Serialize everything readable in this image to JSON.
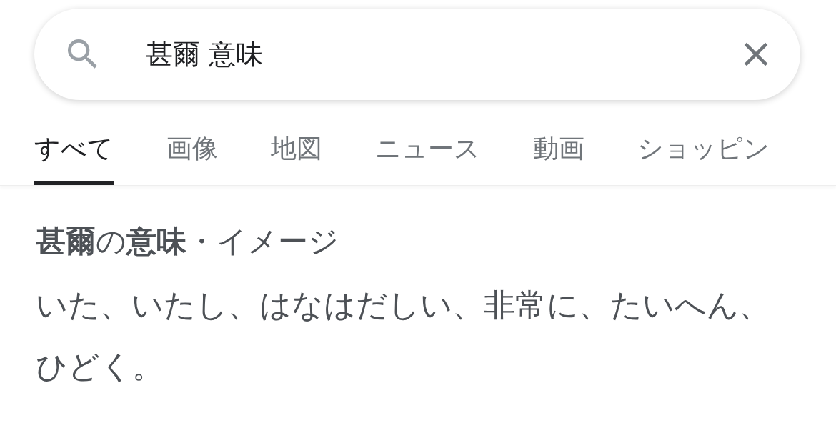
{
  "search": {
    "value": "甚爾 意味"
  },
  "tabs": [
    {
      "label": "すべて",
      "selected": true
    },
    {
      "label": "画像",
      "selected": false
    },
    {
      "label": "地図",
      "selected": false
    },
    {
      "label": "ニュース",
      "selected": false
    },
    {
      "label": "動画",
      "selected": false
    },
    {
      "label": "ショッピン",
      "selected": false
    }
  ],
  "result": {
    "title": "**甚爾**の**意味**・イメージ",
    "text": "いた、いたし、はなはだしい、非常に、たいへん、ひどく。"
  }
}
